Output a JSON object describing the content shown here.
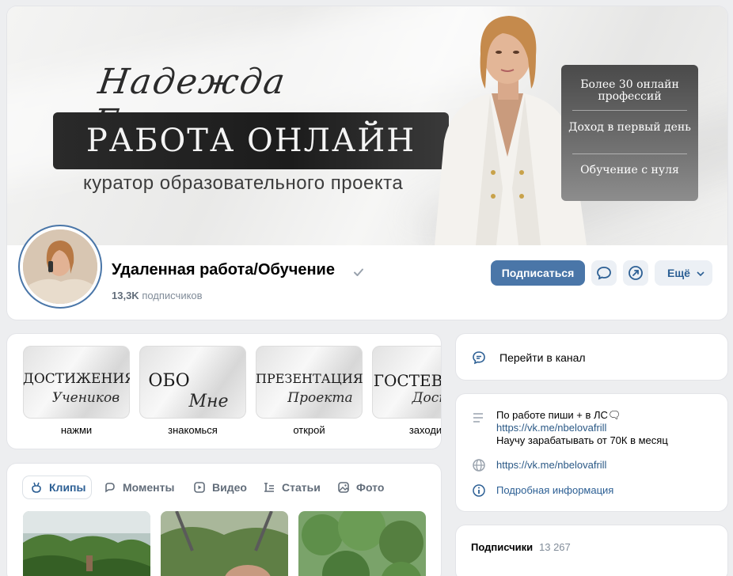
{
  "cover": {
    "script_name": "Надежда Белова",
    "title": "РАБОТА ОНЛАЙН",
    "subtitle": "куратор образовательного проекта",
    "panel": [
      "Более 30 онлайн профессий",
      "Доход в первый день",
      "Обучение с нуля"
    ]
  },
  "group": {
    "name": "Удаленная работа/Обучение",
    "members_count": "13,3K",
    "members_suffix": " подписчиков"
  },
  "actions": {
    "subscribe": "Подписаться",
    "more": "Ещё"
  },
  "stories": [
    {
      "main": "ДОСТИЖЕНИЯ",
      "script": "Учеников",
      "label": "нажми"
    },
    {
      "main": "ОБО",
      "script": "Мне",
      "label": "знакомься"
    },
    {
      "main": "ПРЕЗЕНТАЦИЯ",
      "script": "Проекта",
      "label": "открой"
    },
    {
      "main": "ГОСТЕВ",
      "script": "Дост",
      "label": "заходи"
    }
  ],
  "tabs": [
    "Клипы",
    "Моменты",
    "Видео",
    "Статьи",
    "Фото"
  ],
  "channel": {
    "label": "Перейти в канал"
  },
  "info": {
    "line1": "По работе пиши + в ЛС🗨",
    "link1": "https://vk.me/nbelovafrill",
    "line3": "Научу зарабатывать от 70К в месяц",
    "website": "https://vk.me/nbelovafrill",
    "details": "Подробная информация"
  },
  "subscribers": {
    "label": "Подписчики",
    "count": "13 267"
  },
  "colors": {
    "accent": "#4a76a8",
    "link": "#2a5885",
    "page_bg": "#edeef0"
  }
}
